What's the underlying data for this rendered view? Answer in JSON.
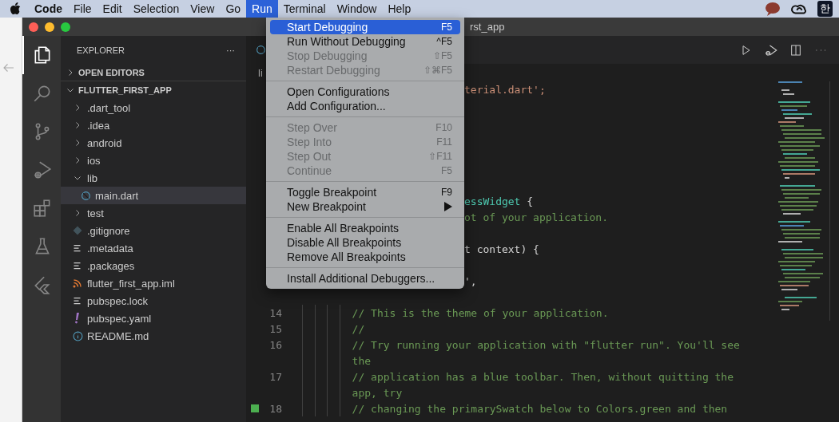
{
  "menu_bar": {
    "app": "Code",
    "items": [
      {
        "label": "File",
        "selected": false
      },
      {
        "label": "Edit",
        "selected": false
      },
      {
        "label": "Selection",
        "selected": false
      },
      {
        "label": "View",
        "selected": false
      },
      {
        "label": "Go",
        "selected": false
      },
      {
        "label": "Run",
        "selected": true
      },
      {
        "label": "Terminal",
        "selected": false
      },
      {
        "label": "Window",
        "selected": false
      },
      {
        "label": "Help",
        "selected": false
      }
    ],
    "input_source": "한"
  },
  "window": {
    "title": "rst_app"
  },
  "activity_bar": [
    {
      "kind": "explorer",
      "selected": true
    },
    {
      "kind": "search",
      "selected": false
    },
    {
      "kind": "source-control",
      "selected": false
    },
    {
      "kind": "run-debug",
      "selected": false
    },
    {
      "kind": "extensions",
      "selected": false
    },
    {
      "kind": "testing",
      "selected": false
    },
    {
      "kind": "flutter",
      "selected": false
    }
  ],
  "sidebar": {
    "title": "EXPLORER",
    "more": "···",
    "sections": [
      {
        "label": "OPEN EDITORS",
        "expanded": false
      }
    ],
    "tree": {
      "label": "FLUTTER_FIRST_APP",
      "expanded": true,
      "children": [
        {
          "label": ".dart_tool",
          "kind": "folder",
          "expanded": false,
          "selected": false
        },
        {
          "label": ".idea",
          "kind": "folder",
          "expanded": false,
          "selected": false
        },
        {
          "label": "android",
          "kind": "folder",
          "expanded": false,
          "selected": false
        },
        {
          "label": "ios",
          "kind": "folder",
          "expanded": false,
          "selected": false
        },
        {
          "label": "lib",
          "kind": "folder",
          "expanded": true,
          "selected": false,
          "children": [
            {
              "label": "main.dart",
              "kind": "dart",
              "selected": true
            }
          ]
        },
        {
          "label": "test",
          "kind": "folder",
          "expanded": false,
          "selected": false
        },
        {
          "label": ".gitignore",
          "kind": "git",
          "selected": false
        },
        {
          "label": ".metadata",
          "kind": "text",
          "selected": false
        },
        {
          "label": ".packages",
          "kind": "text",
          "selected": false
        },
        {
          "label": "flutter_first_app.iml",
          "kind": "feed",
          "selected": false
        },
        {
          "label": "pubspec.lock",
          "kind": "text",
          "selected": false
        },
        {
          "label": "pubspec.yaml",
          "kind": "yaml",
          "selected": false
        },
        {
          "label": "README.md",
          "kind": "info",
          "selected": false
        }
      ]
    }
  },
  "editor": {
    "breadcrumb": "li",
    "lines": [
      {
        "kind": "partial",
        "tokens": [
          {
            "text": "terial.dart';",
            "color": "#ce9178"
          }
        ]
      },
      {
        "kind": "blank"
      },
      {
        "kind": "blank"
      },
      {
        "kind": "blank"
      },
      {
        "kind": "blank"
      },
      {
        "kind": "blank"
      },
      {
        "kind": "blank"
      },
      {
        "kind": "partial",
        "tokens": [
          {
            "text": "essWidget",
            "color": "#4ec9b0"
          },
          {
            "text": " {",
            "color": "#d4d4d4"
          }
        ]
      },
      {
        "kind": "partial",
        "tokens": [
          {
            "text": "ot of your application.",
            "color": "#6a9955"
          }
        ]
      },
      {
        "kind": "blank"
      },
      {
        "kind": "partial",
        "tokens": [
          {
            "text": "t context) {",
            "color": "#d4d4d4"
          }
        ]
      },
      {
        "kind": "blank"
      },
      {
        "kind": "partial",
        "tokens": [
          {
            "text": "',"
          }
        ]
      },
      {
        "kind": "blank"
      },
      {
        "kind": "code",
        "number": "14",
        "tokens": [
          {
            "text": "// This is the theme of your application.",
            "color": "#6a9955"
          }
        ]
      },
      {
        "kind": "code",
        "number": "15",
        "tokens": [
          {
            "text": "//",
            "color": "#6a9955"
          }
        ]
      },
      {
        "kind": "code",
        "number": "16",
        "tokens": [
          {
            "text": "// Try running your application with \"flutter run\". You'll see",
            "color": "#6a9955"
          }
        ]
      },
      {
        "kind": "wrap",
        "tokens": [
          {
            "text": "the",
            "color": "#6a9955"
          }
        ]
      },
      {
        "kind": "code",
        "number": "17",
        "tokens": [
          {
            "text": "// application has a blue toolbar. Then, without quitting the",
            "color": "#6a9955"
          }
        ]
      },
      {
        "kind": "wrap",
        "tokens": [
          {
            "text": "app, try",
            "color": "#6a9955"
          }
        ]
      },
      {
        "kind": "code",
        "number": "18",
        "changed": true,
        "tokens": [
          {
            "text": "// changing the primarySwatch below to Colors.green and then",
            "color": "#6a9955"
          }
        ]
      }
    ]
  },
  "run_menu": {
    "groups": [
      [
        {
          "label": "Start Debugging",
          "shortcut": "F5",
          "disabled": false,
          "selected": true
        },
        {
          "label": "Run Without Debugging",
          "shortcut": "^F5",
          "disabled": false,
          "selected": false
        },
        {
          "label": "Stop Debugging",
          "shortcut": "⇧F5",
          "disabled": true,
          "selected": false
        },
        {
          "label": "Restart Debugging",
          "shortcut": "⇧⌘F5",
          "disabled": true,
          "selected": false
        }
      ],
      [
        {
          "label": "Open Configurations",
          "disabled": false,
          "selected": false
        },
        {
          "label": "Add Configuration...",
          "disabled": false,
          "selected": false
        }
      ],
      [
        {
          "label": "Step Over",
          "shortcut": "F10",
          "disabled": true,
          "selected": false
        },
        {
          "label": "Step Into",
          "shortcut": "F11",
          "disabled": true,
          "selected": false
        },
        {
          "label": "Step Out",
          "shortcut": "⇧F11",
          "disabled": true,
          "selected": false
        },
        {
          "label": "Continue",
          "shortcut": "F5",
          "disabled": true,
          "selected": false
        }
      ],
      [
        {
          "label": "Toggle Breakpoint",
          "shortcut": "F9",
          "disabled": false,
          "selected": false
        },
        {
          "label": "New Breakpoint",
          "submenu": true,
          "disabled": false,
          "selected": false
        }
      ],
      [
        {
          "label": "Enable All Breakpoints",
          "disabled": false,
          "selected": false
        },
        {
          "label": "Disable All Breakpoints",
          "disabled": false,
          "selected": false
        },
        {
          "label": "Remove All Breakpoints",
          "disabled": false,
          "selected": false
        }
      ],
      [
        {
          "label": "Install Additional Debuggers...",
          "disabled": false,
          "selected": false
        }
      ]
    ]
  }
}
